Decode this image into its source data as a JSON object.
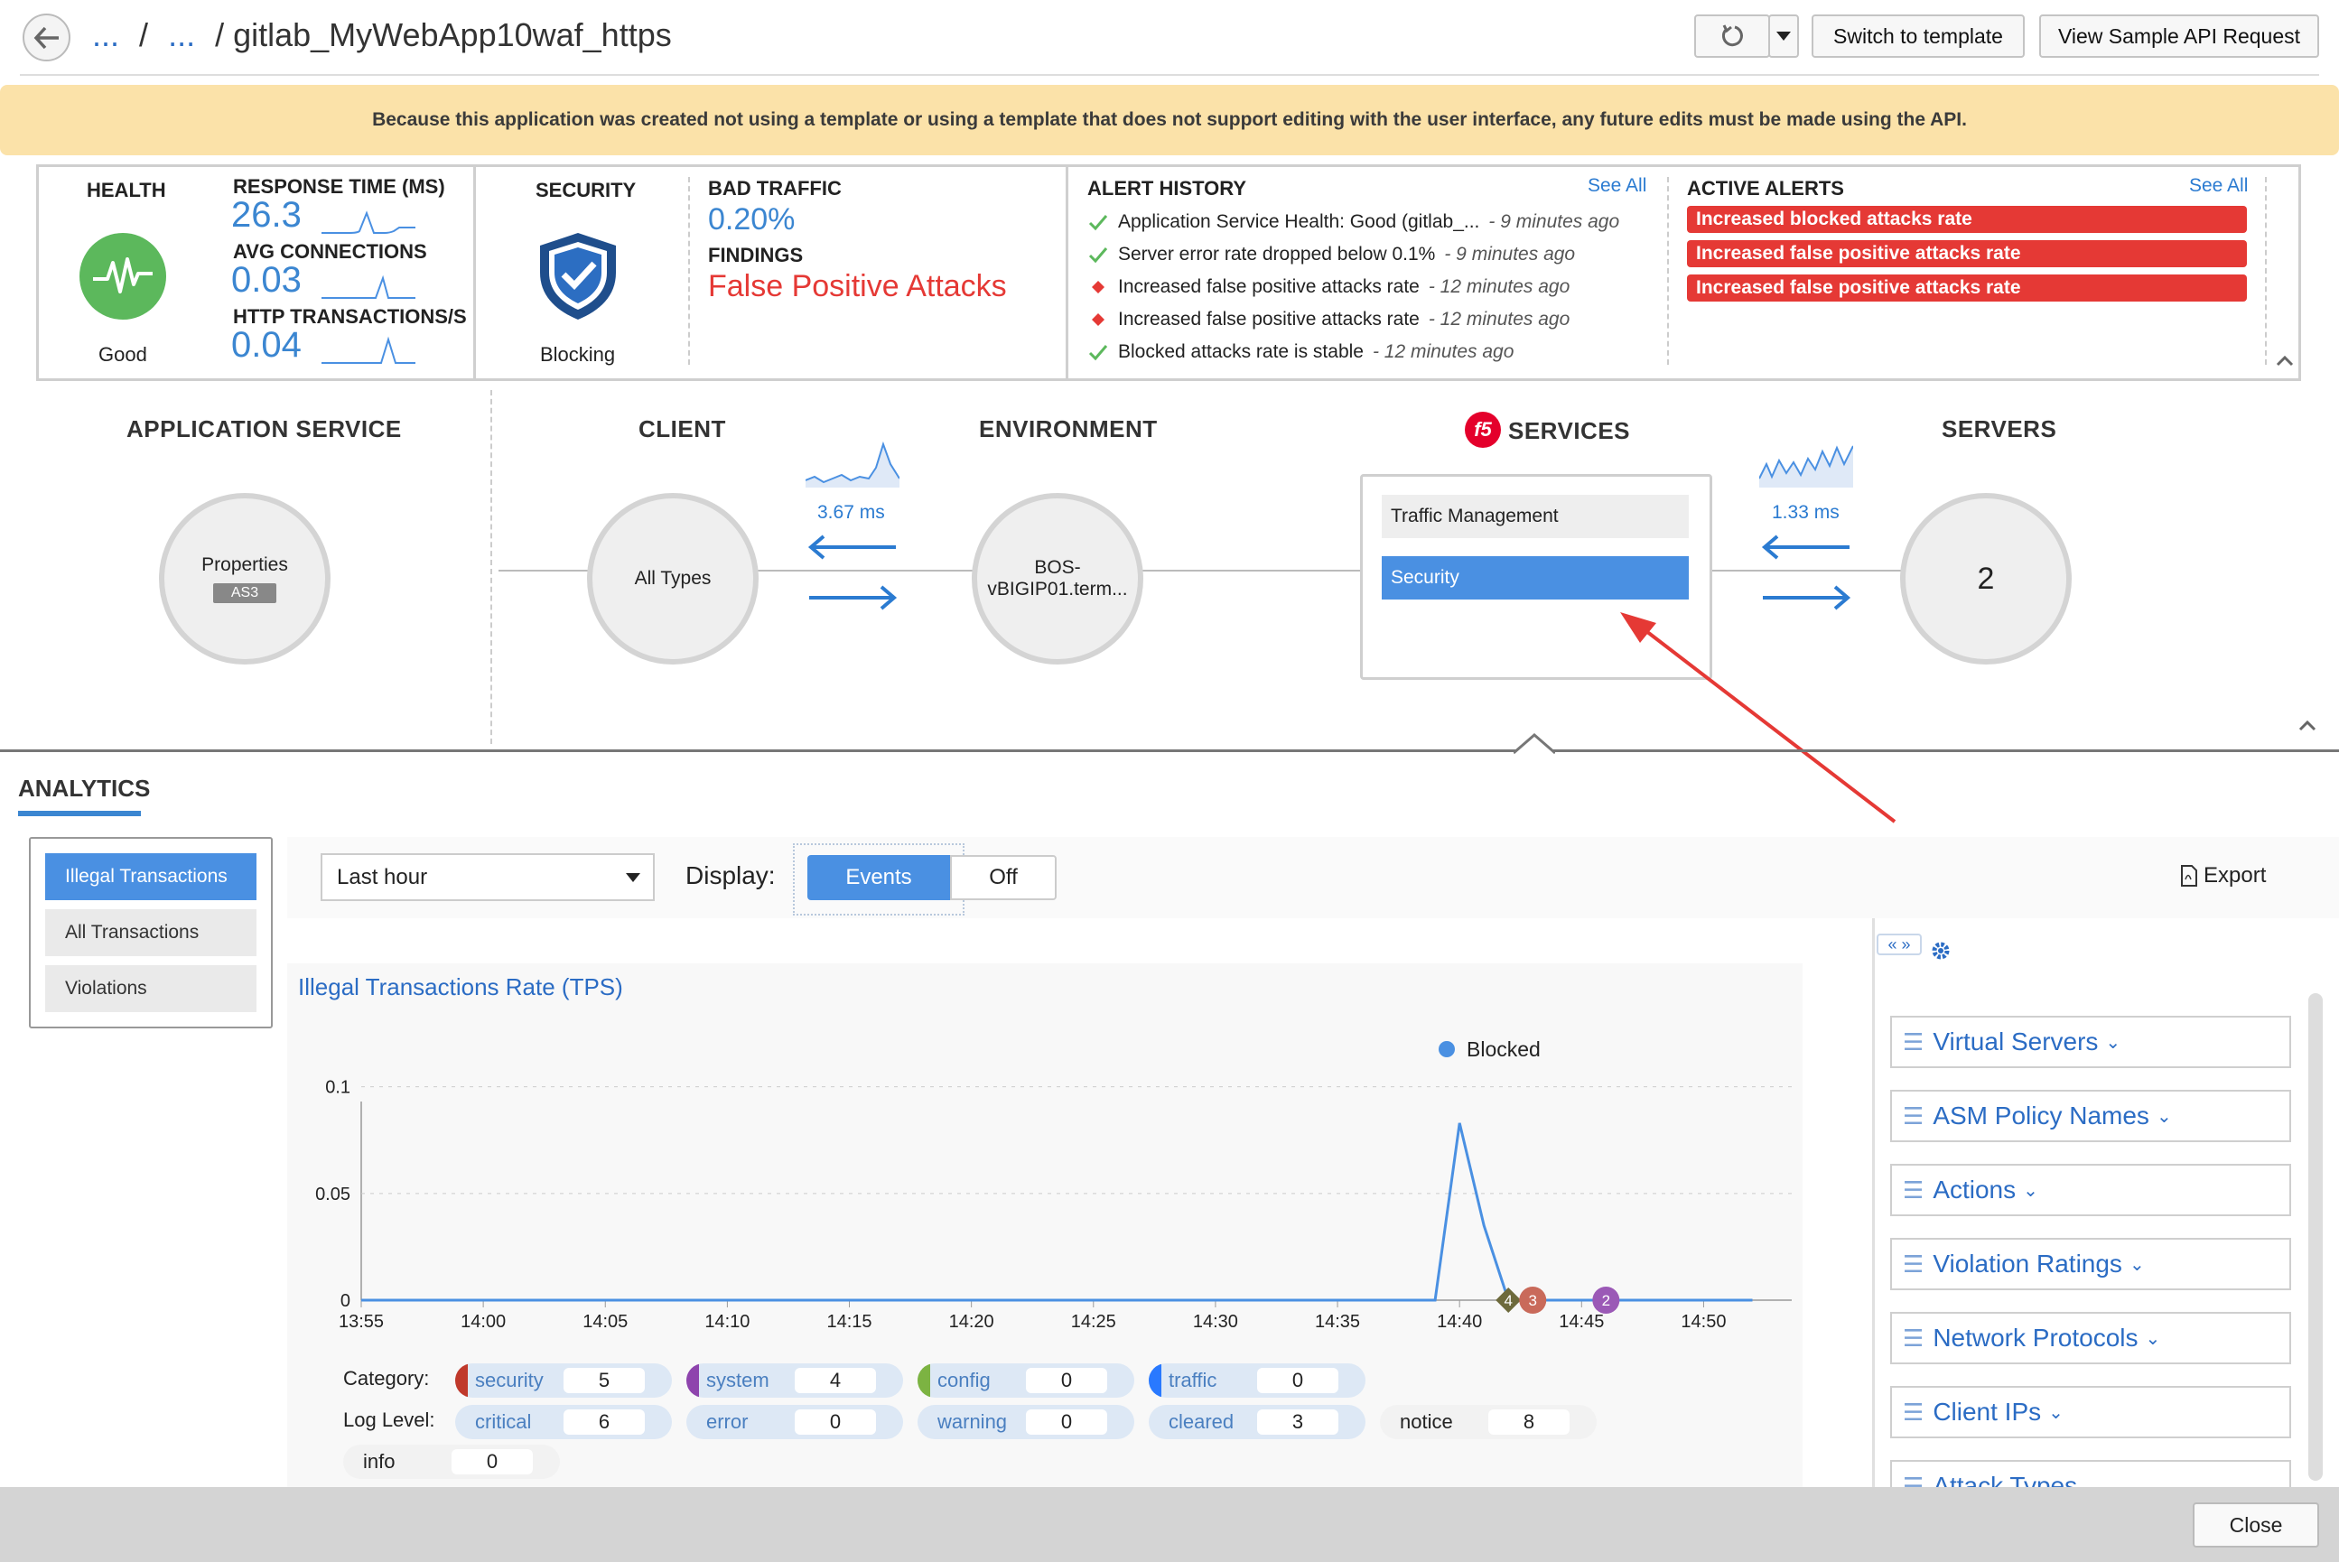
{
  "header": {
    "breadcrumb_1": "...",
    "breadcrumb_sep": "/",
    "breadcrumb_2": "...",
    "title": "/ gitlab_MyWebApp10waf_https",
    "switch_template": "Switch to template",
    "view_api": "View Sample API Request"
  },
  "banner": {
    "text": "Because this application was created not using a template or using a template that does not support editing with the user interface, any future edits must be made using the API."
  },
  "status": {
    "health_title": "HEALTH",
    "health_value": "Good",
    "response_time_label": "RESPONSE TIME (MS)",
    "response_time": "26.3",
    "avg_connections_label": "AVG CONNECTIONS",
    "avg_connections": "0.03",
    "http_tps_label": "HTTP TRANSACTIONS/S",
    "http_tps": "0.04",
    "security_title": "SECURITY",
    "security_value": "Blocking",
    "bad_traffic_label": "BAD TRAFFIC",
    "bad_traffic": "0.20%",
    "findings_label": "FINDINGS",
    "findings": "False Positive Attacks",
    "alert_history_title": "ALERT HISTORY",
    "alert_history_see_all": "See All",
    "alert_history": [
      {
        "text": "Application Service Health: Good (gitlab_...",
        "time": "- 9 minutes ago",
        "status": "ok"
      },
      {
        "text": "Server error rate dropped below 0.1%",
        "time": "- 9 minutes ago",
        "status": "ok"
      },
      {
        "text": "Increased false positive attacks rate",
        "time": "- 12 minutes ago",
        "status": "alert"
      },
      {
        "text": "Increased false positive attacks rate",
        "time": "- 12 minutes ago",
        "status": "alert"
      },
      {
        "text": "Blocked attacks rate is stable",
        "time": "- 12 minutes ago",
        "status": "ok"
      }
    ],
    "active_alerts_title": "ACTIVE ALERTS",
    "active_alerts_see_all": "See All",
    "active_alerts": [
      "Increased blocked attacks rate",
      "Increased false positive attacks rate",
      "Increased false positive attacks rate"
    ]
  },
  "flow": {
    "app_service_title": "APPLICATION SERVICE",
    "properties_label": "Properties",
    "as3_badge": "AS3",
    "client_title": "CLIENT",
    "client_value": "All Types",
    "client_latency": "3.67 ms",
    "environment_title": "ENVIRONMENT",
    "environment_value_1": "BOS-",
    "environment_value_2": "vBIGIP01.term...",
    "services_logo": "f5",
    "services_title": "SERVICES",
    "svc_traffic": "Traffic Management",
    "svc_security": "Security",
    "server_latency": "1.33 ms",
    "servers_title": "SERVERS",
    "servers_count": "2"
  },
  "analytics": {
    "title": "ANALYTICS",
    "nav": [
      "Illegal Transactions",
      "All Transactions",
      "Violations"
    ],
    "time_range": "Last hour",
    "display_label": "Display:",
    "display_events": "Events",
    "display_off": "Off",
    "export": "Export",
    "chart_title": "Illegal Transactions Rate (TPS)",
    "category_label": "Category:",
    "log_level_label": "Log Level:",
    "categories": [
      {
        "name": "security",
        "value": "5",
        "color": "#c0392b"
      },
      {
        "name": "system",
        "value": "4",
        "color": "#8e44ad"
      },
      {
        "name": "config",
        "value": "0",
        "color": "#7cb342"
      },
      {
        "name": "traffic",
        "value": "0",
        "color": "#2979ff"
      }
    ],
    "log_levels": [
      {
        "name": "critical",
        "value": "6"
      },
      {
        "name": "error",
        "value": "0"
      },
      {
        "name": "warning",
        "value": "0"
      },
      {
        "name": "cleared",
        "value": "3"
      },
      {
        "name": "notice",
        "value": "8"
      },
      {
        "name": "info",
        "value": "0"
      }
    ],
    "facets": [
      "Virtual Servers",
      "ASM Policy Names",
      "Actions",
      "Violation Ratings",
      "Network Protocols",
      "Client IPs",
      "Attack Types"
    ],
    "close": "Close"
  },
  "chart_data": {
    "type": "line",
    "title": "Illegal Transactions Rate (TPS)",
    "legend": [
      "Blocked"
    ],
    "x_ticks": [
      "13:55",
      "14:00",
      "14:05",
      "14:10",
      "14:15",
      "14:20",
      "14:25",
      "14:30",
      "14:35",
      "14:40",
      "14:45",
      "14:50"
    ],
    "y_ticks": [
      "0",
      "0.05",
      "0.1"
    ],
    "ylim": [
      0,
      0.11
    ],
    "series": [
      {
        "name": "Blocked",
        "color": "#4a90e2",
        "points": [
          [
            "13:55",
            0
          ],
          [
            "14:39",
            0
          ],
          [
            "14:40",
            0.083
          ],
          [
            "14:41",
            0.035
          ],
          [
            "14:42",
            0
          ],
          [
            "14:52",
            0
          ]
        ]
      }
    ],
    "event_markers": [
      {
        "x": "14:42",
        "label": "4",
        "color": "#6d6a3c",
        "shape": "diamond"
      },
      {
        "x": "14:43",
        "label": "3",
        "color": "#c96a5a",
        "shape": "circle"
      },
      {
        "x": "14:46",
        "label": "2",
        "color": "#9b59b6",
        "shape": "circle"
      }
    ]
  }
}
